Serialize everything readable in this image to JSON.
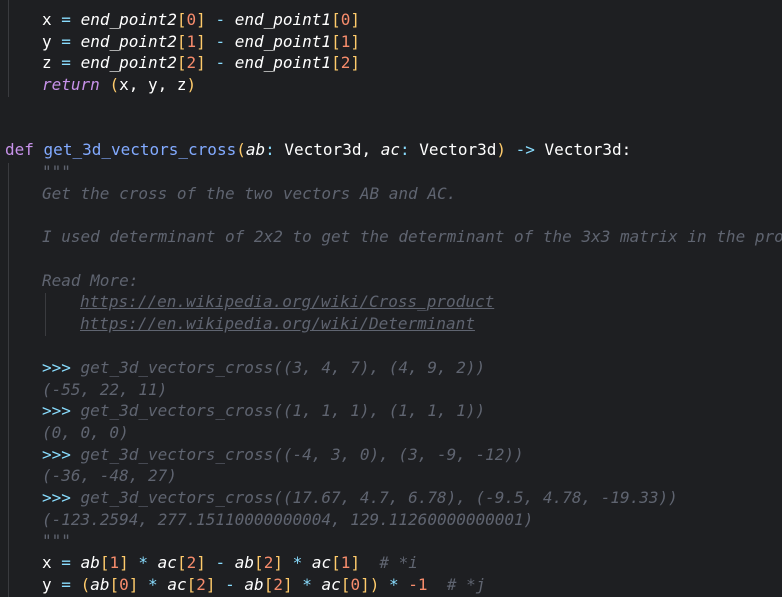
{
  "lines": {
    "l1": {
      "kw1": "x",
      "op1": "=",
      "v1": "end_point2",
      "b1": "[",
      "n1": "0",
      "b2": "]",
      "op2": "-",
      "v2": "end_point1",
      "b3": "[",
      "n2": "0",
      "b4": "]"
    },
    "l2": {
      "kw1": "y",
      "op1": "=",
      "v1": "end_point2",
      "b1": "[",
      "n1": "1",
      "b2": "]",
      "op2": "-",
      "v2": "end_point1",
      "b3": "[",
      "n2": "1",
      "b4": "]"
    },
    "l3": {
      "kw1": "z",
      "op1": "=",
      "v1": "end_point2",
      "b1": "[",
      "n1": "2",
      "b2": "]",
      "op2": "-",
      "v2": "end_point1",
      "b3": "[",
      "n2": "2",
      "b4": "]"
    },
    "l4": {
      "kw": "return",
      "open": "(",
      "body": "x, y, z",
      "close": ")"
    },
    "l7": {
      "def": "def",
      "fn": "get_3d_vectors_cross",
      "open": "(",
      "p1": "ab",
      "c1": ":",
      "t1": "Vector3d,",
      "p2": "ac",
      "c2": ":",
      "t2": "Vector3d",
      "close": ")",
      "arrow": "->",
      "ret": "Vector3d:"
    },
    "l8": "\"\"\"",
    "l9": "Get the cross of the two vectors AB and AC.",
    "l11": "I used determinant of 2x2 to get the determinant of the 3x3 matrix in the pro",
    "l13": "Read More:",
    "l14": "https://en.wikipedia.org/wiki/Cross_product",
    "l15": "https://en.wikipedia.org/wiki/Determinant",
    "l17": {
      "prompt": ">>>",
      "code": "get_3d_vectors_cross((3, 4, 7), (4, 9, 2))"
    },
    "l18": "(-55, 22, 11)",
    "l19": {
      "prompt": ">>>",
      "code": "get_3d_vectors_cross((1, 1, 1), (1, 1, 1))"
    },
    "l20": "(0, 0, 0)",
    "l21": {
      "prompt": ">>>",
      "code": "get_3d_vectors_cross((-4, 3, 0), (3, -9, -12))"
    },
    "l22": "(-36, -48, 27)",
    "l23": {
      "prompt": ">>>",
      "code": "get_3d_vectors_cross((17.67, 4.7, 6.78), (-9.5, 4.78, -19.33))"
    },
    "l24": "(-123.2594, 277.15110000000004, 129.11260000000001)",
    "l25": "\"\"\"",
    "l26": {
      "v": "x",
      "eq": "=",
      "a": "ab",
      "b1": "[",
      "n1": "1",
      "b2": "]",
      "m1": "*",
      "c": "ac",
      "b3": "[",
      "n2": "2",
      "b4": "]",
      "minus": "-",
      "a2": "ab",
      "b5": "[",
      "n3": "2",
      "b6": "]",
      "m2": "*",
      "c2": "ac",
      "b7": "[",
      "n4": "1",
      "b8": "]",
      "cmt": "# *i"
    },
    "l27": {
      "v": "y",
      "eq": "=",
      "po": "(",
      "a": "ab",
      "b1": "[",
      "n1": "0",
      "b2": "]",
      "m1": "*",
      "c": "ac",
      "b3": "[",
      "n2": "2",
      "b4": "]",
      "minus": "-",
      "a2": "ab",
      "b5": "[",
      "n3": "2",
      "b6": "]",
      "m2": "*",
      "c2": "ac",
      "b7": "[",
      "n4": "0",
      "b8": "]",
      "pc": ")",
      "m3": "*",
      "neg": "-1",
      "cmt": "# *j"
    }
  }
}
